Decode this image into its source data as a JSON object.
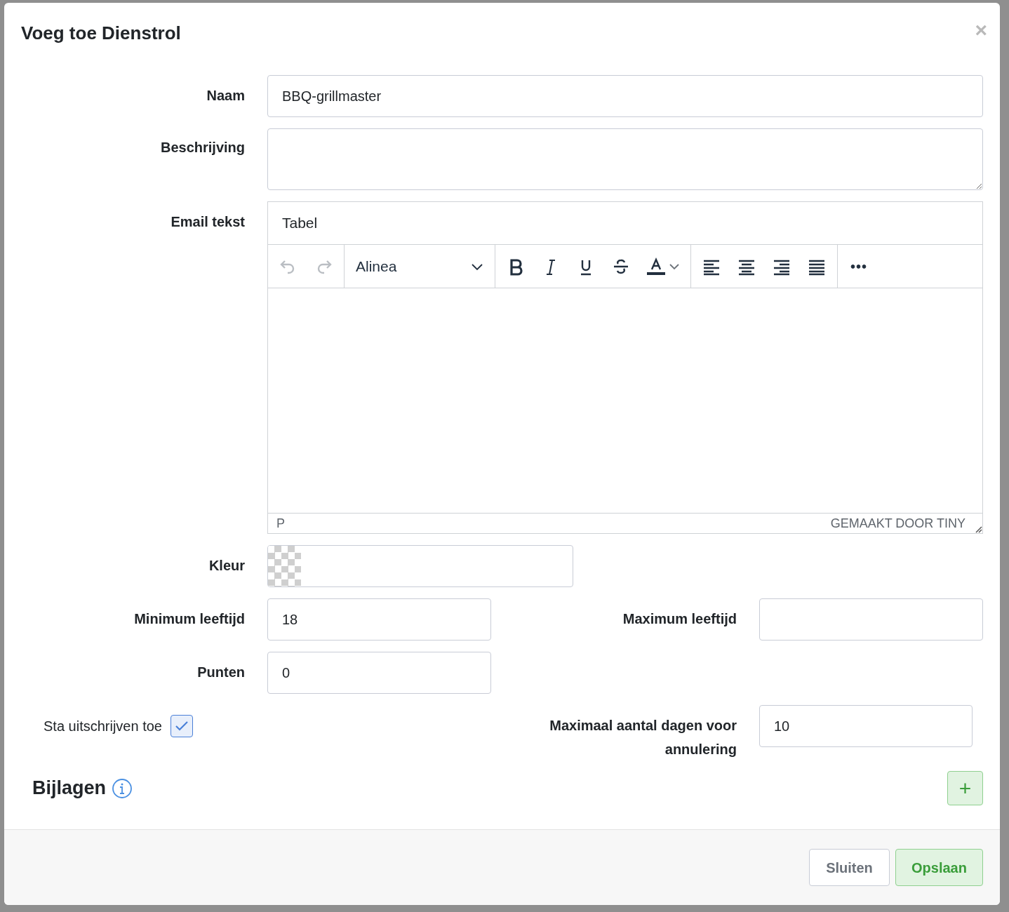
{
  "dialog": {
    "title": "Voeg toe Dienstrol",
    "close": "×"
  },
  "fields": {
    "name": {
      "label": "Naam",
      "value": "BBQ-grillmaster"
    },
    "description": {
      "label": "Beschrijving"
    },
    "email": {
      "label": "Email tekst",
      "menu": [
        "Tabel"
      ],
      "block_format": "Alinea",
      "toolbar": [
        [
          {
            "kind": "undo",
            "disabled": true
          },
          {
            "kind": "redo",
            "disabled": true
          }
        ],
        [
          {
            "kind": "format",
            "disabled": false
          }
        ],
        [
          {
            "kind": "bold",
            "disabled": false
          },
          {
            "kind": "italic",
            "disabled": false
          },
          {
            "kind": "underline",
            "disabled": false
          },
          {
            "kind": "strike",
            "disabled": false
          },
          {
            "kind": "textcolor",
            "disabled": false
          }
        ],
        [
          {
            "kind": "alignleft",
            "disabled": false
          },
          {
            "kind": "aligncenter",
            "disabled": false
          },
          {
            "kind": "alignright",
            "disabled": false
          },
          {
            "kind": "justify",
            "disabled": false
          }
        ],
        [
          {
            "kind": "more",
            "disabled": false
          }
        ]
      ],
      "path": "P",
      "branding": "GEMAAKT DOOR TINY"
    },
    "color": {
      "label": "Kleur"
    },
    "min_age": {
      "label": "Minimum leeftijd",
      "value": "18"
    },
    "max_age": {
      "label": "Maximum leeftijd"
    },
    "points": {
      "label": "Punten",
      "value": "0"
    },
    "allow_unsubscribe": {
      "label": "Sta uitschrijven toe",
      "checked": true
    },
    "max_days": {
      "label": "Maximaal aantal dagen voor annulering",
      "value": "10"
    }
  },
  "attachments": {
    "title": "Bijlagen",
    "add": "+"
  },
  "buttons": {
    "close": "Sluiten",
    "save": "Opslaan"
  }
}
